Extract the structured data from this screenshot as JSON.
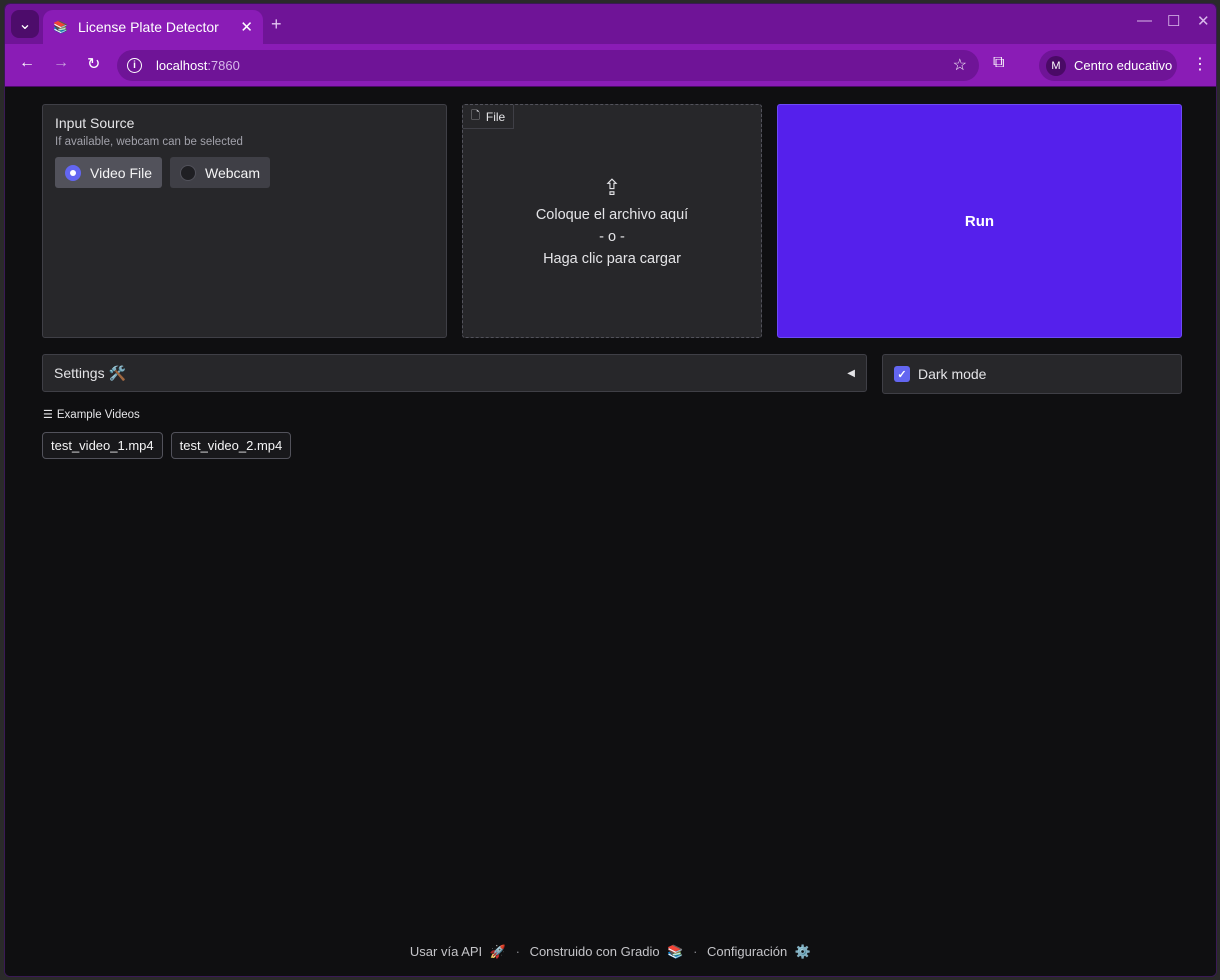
{
  "browser": {
    "tab_title": "License Plate Detector",
    "tab_favicon": "📚",
    "url_host": "localhost",
    "url_port": ":7860",
    "profile_initial": "M",
    "profile_name": "Centro educativo"
  },
  "input_source": {
    "label": "Input Source",
    "info": "If available, webcam can be selected",
    "options": [
      "Video File",
      "Webcam"
    ],
    "selected": "Video File"
  },
  "file_upload": {
    "label": "File",
    "drop_text": "Coloque el archivo aquí",
    "or_text": "- o -",
    "click_text": "Haga clic para cargar"
  },
  "run_button": {
    "label": "Run"
  },
  "settings": {
    "label": "Settings 🛠️"
  },
  "dark_mode": {
    "label": "Dark mode",
    "checked": true
  },
  "examples": {
    "label": "Example Videos",
    "items": [
      "test_video_1.mp4",
      "test_video_2.mp4"
    ]
  },
  "footer": {
    "api": "Usar vía API",
    "api_icon": "🚀",
    "built": "Construido con Gradio",
    "built_icon": "📚",
    "settings": "Configuración",
    "settings_icon": "⚙️"
  }
}
